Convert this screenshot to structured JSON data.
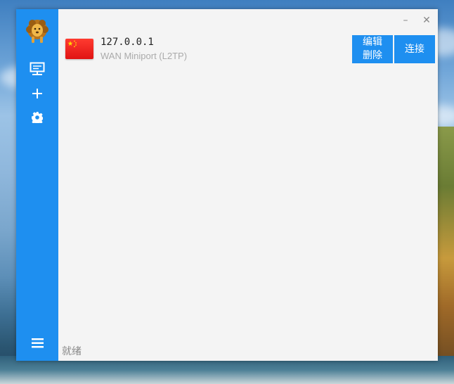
{
  "window": {
    "minimize_icon": "minimize-icon",
    "close_icon": "close-icon",
    "minimize_glyph": "–",
    "close_glyph": "✕"
  },
  "sidebar": {
    "logo": "lion-logo",
    "items": [
      {
        "icon": "server-list-icon"
      },
      {
        "icon": "add-icon",
        "glyph": "+"
      },
      {
        "icon": "settings-icon"
      }
    ],
    "menu_icon": "menu-icon"
  },
  "servers": [
    {
      "flag": "china-flag",
      "ip": "127.0.0.1",
      "description": "WAN Miniport (L2TP)",
      "edit_label": "编辑",
      "delete_label": "删除",
      "connect_label": "连接"
    }
  ],
  "status": {
    "text": "就绪"
  },
  "colors": {
    "accent": "#1e8ff0",
    "window_bg": "#f4f4f4",
    "flag_red": "#e01414",
    "flag_star": "#ffde00"
  }
}
